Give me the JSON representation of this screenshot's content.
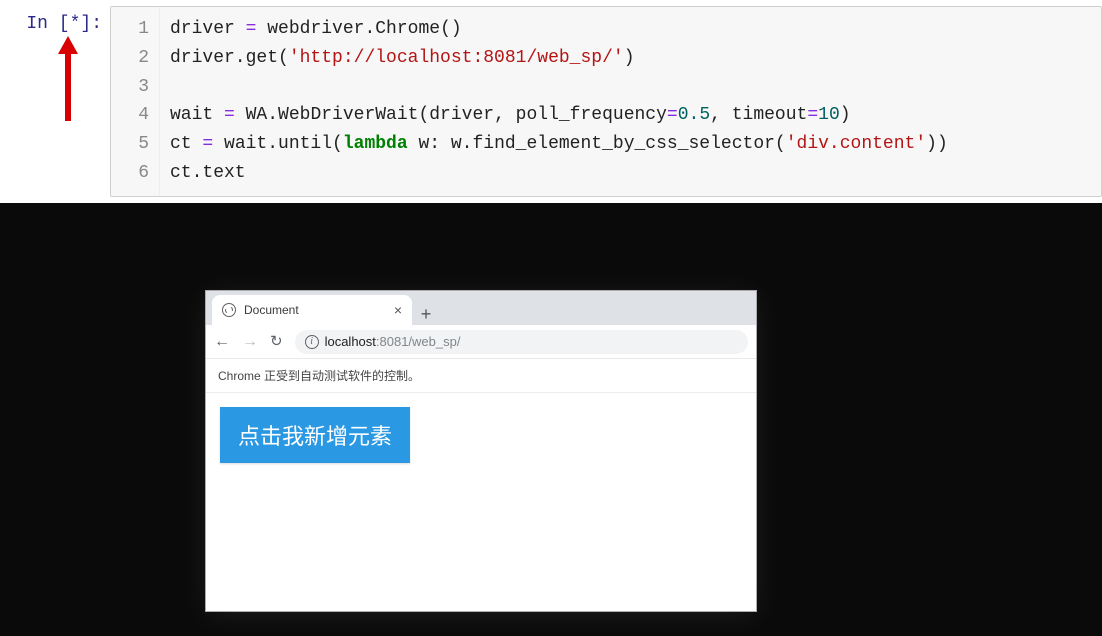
{
  "jupyter": {
    "prompt_in": "In ",
    "prompt_bracket_open": "[",
    "prompt_star": "*",
    "prompt_bracket_close": "]:",
    "line_numbers": [
      "1",
      "2",
      "3",
      "4",
      "5",
      "6"
    ],
    "code": {
      "l1_a": "driver ",
      "l1_eq": "=",
      "l1_b": " webdriver.Chrome()",
      "l2_a": "driver.get(",
      "l2_str": "'http://localhost:8081/web_sp/'",
      "l2_b": ")",
      "l3": "",
      "l4_a": "wait ",
      "l4_eq": "=",
      "l4_b": " WA.WebDriverWait(driver, poll_frequency",
      "l4_eq2": "=",
      "l4_num1": "0.5",
      "l4_c": ", timeout",
      "l4_eq3": "=",
      "l4_num2": "10",
      "l4_d": ")",
      "l5_a": "ct ",
      "l5_eq": "=",
      "l5_b": " wait.until(",
      "l5_kw": "lambda",
      "l5_c": " w: w.find_element_by_css_selector(",
      "l5_str": "'div.content'",
      "l5_d": "))",
      "l6": "ct.text"
    }
  },
  "browser": {
    "tab_title": "Document",
    "tab_close": "×",
    "new_tab": "+",
    "nav_back": "←",
    "nav_forward": "→",
    "nav_reload": "↻",
    "site_info_glyph": "i",
    "url_host": "localhost",
    "url_rest": ":8081/web_sp/",
    "automation_banner": "Chrome 正受到自动测试软件的控制。",
    "big_button_label": "点击我新增元素"
  }
}
